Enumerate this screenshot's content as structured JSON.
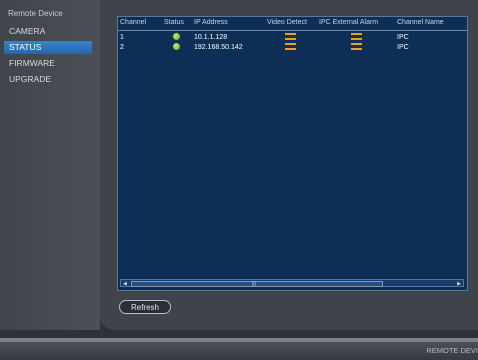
{
  "sidebar": {
    "title": "Remote Device",
    "items": [
      {
        "label": "CAMERA",
        "active": false
      },
      {
        "label": "STATUS",
        "active": true
      },
      {
        "label": "FIRMWARE",
        "active": false
      },
      {
        "label": "UPGRADE",
        "active": false
      }
    ]
  },
  "table": {
    "columns": [
      "Channel",
      "Status",
      "IP Address",
      "Video Detect",
      "IPC External Alarm",
      "Channel Name"
    ],
    "rows": [
      {
        "channel": "1",
        "status": "online",
        "ip": "10.1.1.128",
        "video_detect": "alarm-icon",
        "ipc_external_alarm": "alarm-icon",
        "channel_name": "IPC"
      },
      {
        "channel": "2",
        "status": "online",
        "ip": "192.168.50.142",
        "video_detect": "alarm-icon",
        "ipc_external_alarm": "alarm-icon",
        "channel_name": "IPC"
      }
    ],
    "scrollbar_grip": "|||"
  },
  "buttons": {
    "refresh_label": "Refresh"
  },
  "footer": {
    "label": "REMOTE DEVI"
  },
  "colors": {
    "accent": "#3b82c6",
    "grid_background": "#0e2f55",
    "status_online": "#7ec33a",
    "alarm_icon": "#e0a02a"
  }
}
